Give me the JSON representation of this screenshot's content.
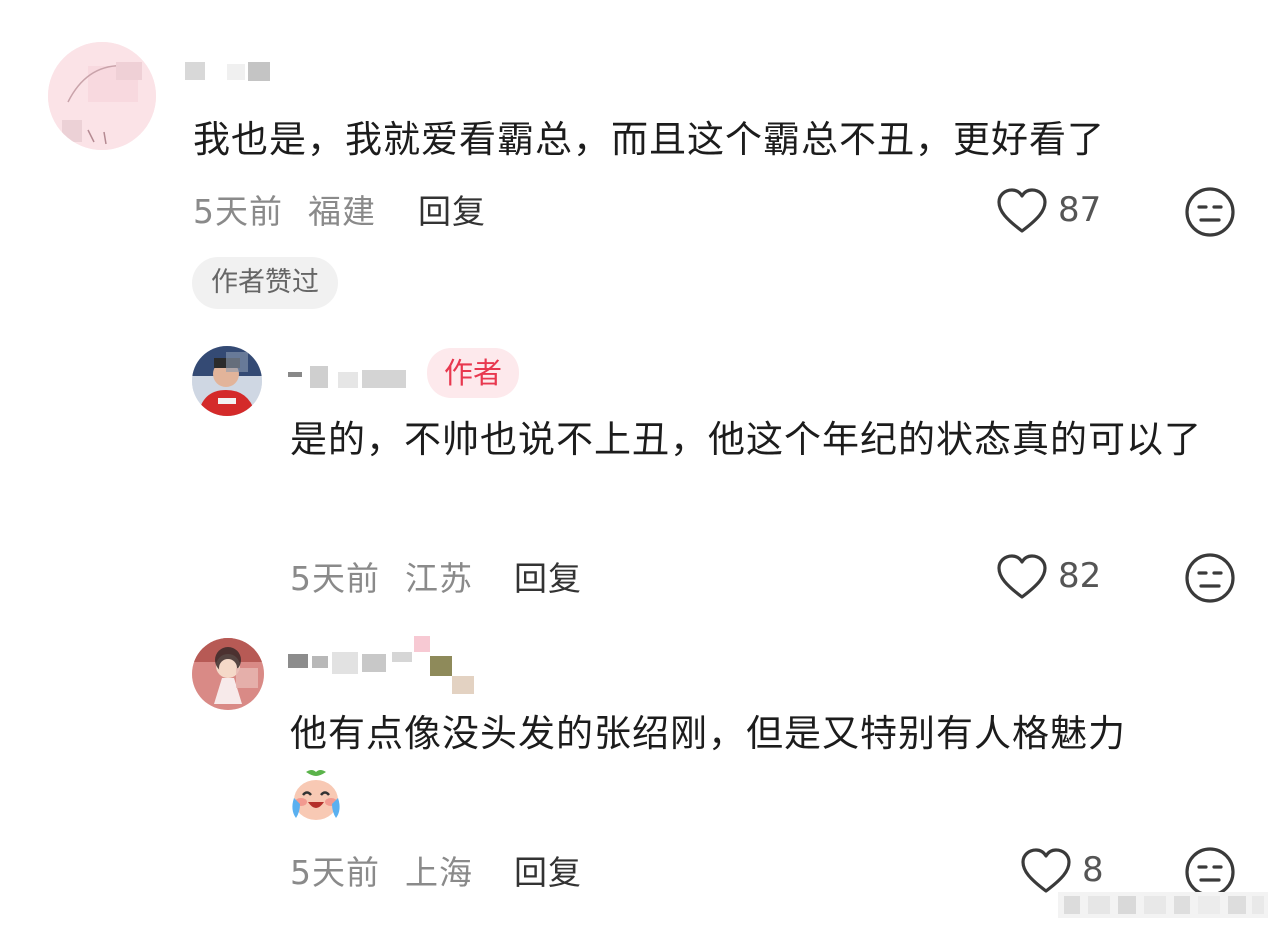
{
  "comments": [
    {
      "text": "我也是，我就爱看霸总，而且这个霸总不丑，更好看了",
      "time": "5天前",
      "location": "福建",
      "reply_label": "回复",
      "likes": "87",
      "liked_tag": "作者赞过"
    },
    {
      "author_tag": "作者",
      "text": "是的，不帅也说不上丑，他这个年纪的状态真的可以了",
      "time": "5天前",
      "location": "江苏",
      "reply_label": "回复",
      "likes": "82"
    },
    {
      "text": "他有点像没头发的张绍刚，但是又特别有人格魅力",
      "emoji": "laughing-crying-emoji",
      "time": "5天前",
      "location": "上海",
      "reply_label": "回复",
      "likes": "8"
    }
  ],
  "colors": {
    "author_tag_text": "#e8384f",
    "author_tag_bg": "#fde9ec",
    "meta_text": "#8a8a8a",
    "tag_bg": "#f1f1f1"
  }
}
